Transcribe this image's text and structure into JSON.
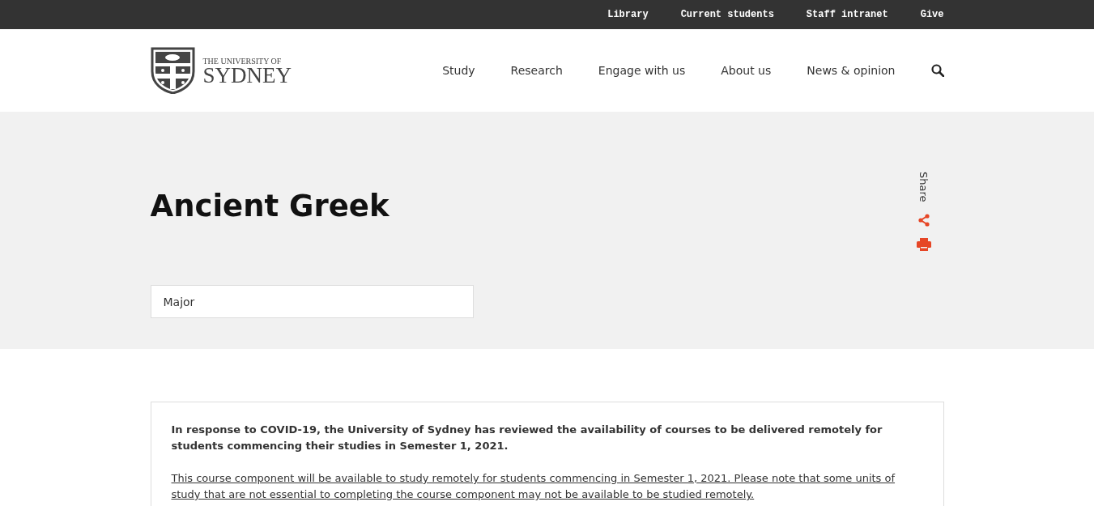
{
  "utility_nav": [
    "Library",
    "Current students",
    "Staff intranet",
    "Give"
  ],
  "logo": {
    "line_1": "THE UNIVERSITY OF",
    "line_2": "SYDNEY"
  },
  "main_nav": [
    "Study",
    "Research",
    "Engage with us",
    "About us",
    "News & opinion"
  ],
  "hero": {
    "title": "Ancient Greek",
    "share_label": "Share",
    "type_tag": "Major"
  },
  "notice": {
    "heading": "In response to COVID-19, the University of Sydney has reviewed the availability of courses to be delivered remotely for students commencing their studies in Semester 1, 2021.",
    "link": "This course component will be available to study remotely for students commencing in Semester 1, 2021. Please note that some units of study that are not essential to completing the course component may not be available to be studied remotely."
  }
}
